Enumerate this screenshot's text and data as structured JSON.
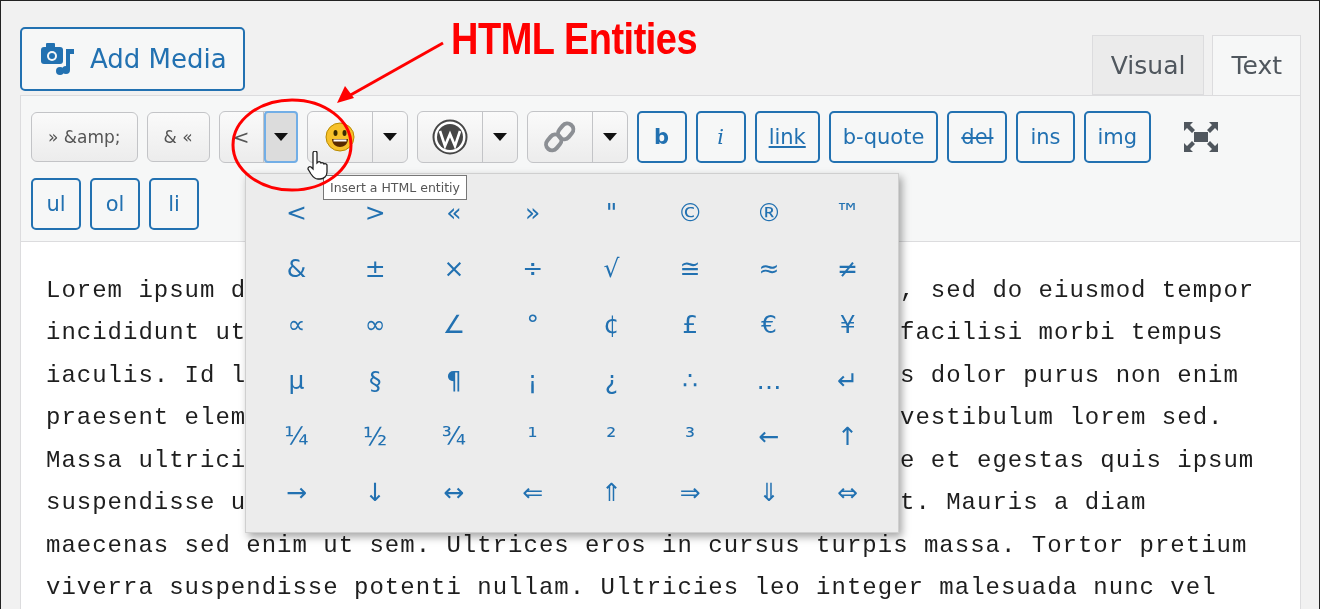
{
  "annotation": {
    "label": "HTML Entities"
  },
  "add_media": {
    "label": "Add Media"
  },
  "tabs": [
    {
      "label": "Visual",
      "selected": false
    },
    {
      "label": "Text",
      "selected": true
    }
  ],
  "toolbar_rows": [
    [
      {
        "kind": "plain",
        "label": "» &amp;"
      },
      {
        "kind": "plain",
        "label": "& «"
      },
      {
        "kind": "entities",
        "label": "<",
        "open": true
      },
      {
        "kind": "emoji",
        "open": false
      },
      {
        "kind": "logo",
        "open": false
      },
      {
        "kind": "chain",
        "open": false
      },
      {
        "kind": "tag",
        "label": "b",
        "bold": true
      },
      {
        "kind": "tag",
        "label": "i",
        "italic": true
      },
      {
        "kind": "tag",
        "label": "link",
        "underline": true
      },
      {
        "kind": "tag",
        "label": "b-quote"
      },
      {
        "kind": "tag",
        "label": "del",
        "strike": true
      },
      {
        "kind": "tag",
        "label": "ins"
      },
      {
        "kind": "tag",
        "label": "img"
      },
      {
        "kind": "fullscreen"
      }
    ],
    [
      {
        "kind": "tag",
        "label": "ul"
      },
      {
        "kind": "tag",
        "label": "ol"
      },
      {
        "kind": "tag",
        "label": "li"
      }
    ]
  ],
  "entity_menu": {
    "tooltip": "Insert a HTML entitiy",
    "entities": [
      "<",
      ">",
      "«",
      "»",
      "\"",
      "©",
      "®",
      "™",
      "&",
      "±",
      "×",
      "÷",
      "√",
      "≅",
      "≈",
      "≠",
      "∝",
      "∞",
      "∠",
      "°",
      "¢",
      "£",
      "€",
      "¥",
      "µ",
      "§",
      "¶",
      "¡",
      "¿",
      "∴",
      "…",
      "↵",
      "¼",
      "½",
      "¾",
      "¹",
      "²",
      "³",
      "←",
      "↑",
      "→",
      "↓",
      "↔",
      "⇐",
      "⇑",
      "⇒",
      "⇓",
      "⇔"
    ]
  },
  "lines": [
    {
      "left": "Lorem ipsum d",
      "right": ", sed do eiusmod tempor"
    },
    {
      "left": "incididunt ut",
      "right": "facilisi morbi tempus"
    },
    {
      "left": "iaculis. Id l",
      "right": "s dolor purus non enim"
    },
    {
      "left": "praesent elem",
      "right": "vestibulum lorem sed."
    },
    {
      "left": "Massa ultrici",
      "right": "e et egestas quis ipsum"
    },
    {
      "left": "suspendisse u",
      "right": "t. Mauris a diam"
    },
    {
      "text": "maecenas sed enim ut sem. Ultrices eros in cursus turpis massa. Tortor pretium"
    },
    {
      "text": "viverra suspendisse potenti nullam. Ultricies leo integer malesuada nunc vel"
    }
  ]
}
